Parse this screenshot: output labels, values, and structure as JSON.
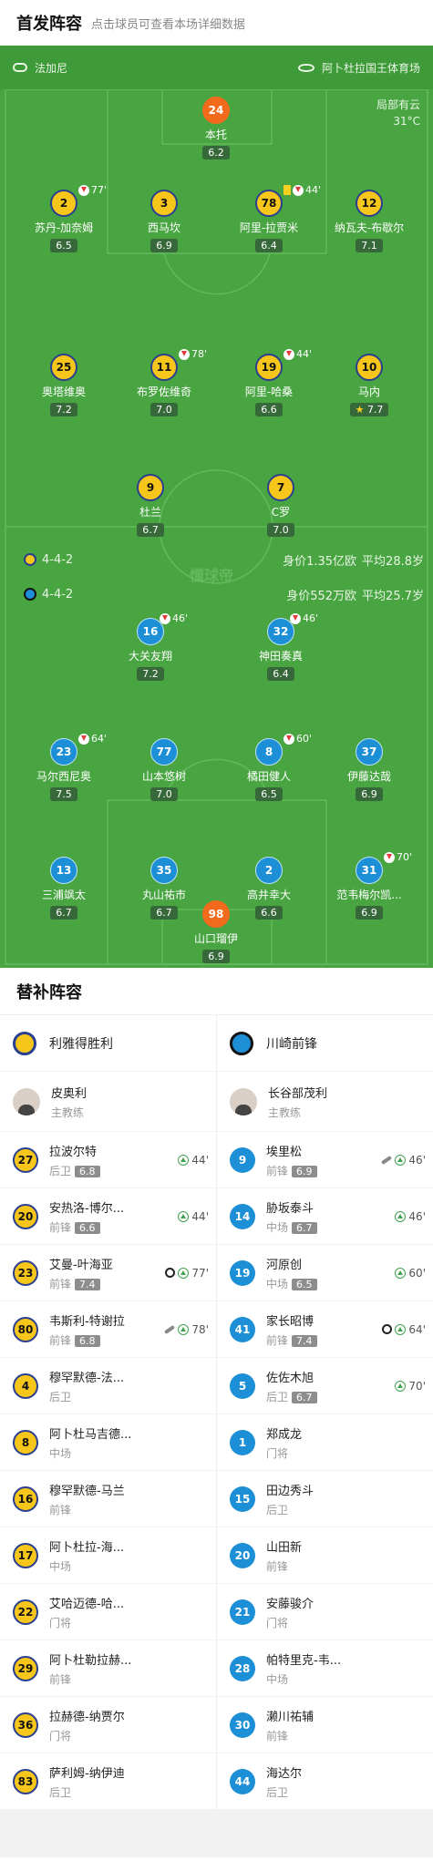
{
  "header": {
    "title": "首发阵容",
    "subtitle": "点击球员可查看本场详细数据"
  },
  "venue": {
    "referee": "法加尼",
    "stadium": "阿卜杜拉国王体育场"
  },
  "weather": {
    "condition": "局部有云",
    "temp": "31°C"
  },
  "home": {
    "formation": "4-4-2",
    "value": "身价1.35亿欧",
    "age": "平均28.8岁"
  },
  "away": {
    "formation": "4-4-2",
    "value": "身价552万欧",
    "age": "平均25.7岁"
  },
  "watermark": "懂球帝",
  "home_players": [
    {
      "num": "24",
      "name": "本托",
      "rating": "6.2",
      "gk": true
    },
    {
      "num": "2",
      "name": "苏丹-加奈姆",
      "rating": "6.5",
      "event": "77'"
    },
    {
      "num": "3",
      "name": "西马坎",
      "rating": "6.9"
    },
    {
      "num": "78",
      "name": "阿里-拉贾米",
      "rating": "6.4",
      "event": "44'"
    },
    {
      "num": "12",
      "name": "纳瓦夫-布歇尔",
      "rating": "7.1"
    },
    {
      "num": "25",
      "name": "奥塔维奥",
      "rating": "7.2"
    },
    {
      "num": "11",
      "name": "布罗佐维奇",
      "rating": "7.0",
      "event": "78'"
    },
    {
      "num": "19",
      "name": "阿里-哈桑",
      "rating": "6.6",
      "event": "44'"
    },
    {
      "num": "10",
      "name": "马内",
      "rating": "7.7"
    },
    {
      "num": "9",
      "name": "杜兰",
      "rating": "6.7"
    },
    {
      "num": "7",
      "name": "C罗",
      "rating": "7.0"
    }
  ],
  "away_players": [
    {
      "num": "16",
      "name": "大关友翔",
      "rating": "7.2",
      "event": "46'"
    },
    {
      "num": "32",
      "name": "神田奏真",
      "rating": "6.4",
      "event": "46'"
    },
    {
      "num": "23",
      "name": "马尔西尼奥",
      "rating": "7.5",
      "event": "64'"
    },
    {
      "num": "77",
      "name": "山本悠树",
      "rating": "7.0"
    },
    {
      "num": "8",
      "name": "橘田健人",
      "rating": "6.5",
      "event": "60'"
    },
    {
      "num": "37",
      "name": "伊藤达哉",
      "rating": "6.9"
    },
    {
      "num": "13",
      "name": "三浦飒太",
      "rating": "6.7"
    },
    {
      "num": "35",
      "name": "丸山祐市",
      "rating": "6.7"
    },
    {
      "num": "2",
      "name": "高井幸大",
      "rating": "6.6"
    },
    {
      "num": "31",
      "name": "范韦梅尔凯...",
      "rating": "6.9",
      "event": "70'"
    },
    {
      "num": "98",
      "name": "山口瑠伊",
      "rating": "6.9",
      "gk": true
    }
  ],
  "subs": {
    "title": "替补阵容",
    "home_team": "利雅得胜利",
    "away_team": "川崎前锋",
    "home_coach": {
      "name": "皮奥利",
      "role": "主教练"
    },
    "away_coach": {
      "name": "长谷部茂利",
      "role": "主教练"
    },
    "home": [
      {
        "num": "27",
        "name": "拉波尔特",
        "pos": "后卫",
        "rating": "6.8",
        "in": "44'"
      },
      {
        "num": "20",
        "name": "安热洛-博尔...",
        "pos": "前锋",
        "rating": "6.6",
        "in": "44'"
      },
      {
        "num": "23",
        "name": "艾曼-叶海亚",
        "pos": "前锋",
        "rating": "7.4",
        "in": "77'",
        "goal": true
      },
      {
        "num": "80",
        "name": "韦斯利-特谢拉",
        "pos": "前锋",
        "rating": "6.8",
        "in": "78'",
        "assist": true
      },
      {
        "num": "4",
        "name": "穆罕默德-法...",
        "pos": "后卫"
      },
      {
        "num": "8",
        "name": "阿卜杜马吉德...",
        "pos": "中场"
      },
      {
        "num": "16",
        "name": "穆罕默德-马兰",
        "pos": "前锋"
      },
      {
        "num": "17",
        "name": "阿卜杜拉-海...",
        "pos": "中场"
      },
      {
        "num": "22",
        "name": "艾哈迈德-哈...",
        "pos": "门将"
      },
      {
        "num": "29",
        "name": "阿卜杜勒拉赫...",
        "pos": "前锋"
      },
      {
        "num": "36",
        "name": "拉赫德-纳贾尔",
        "pos": "门将"
      },
      {
        "num": "83",
        "name": "萨利姆-纳伊迪",
        "pos": "后卫"
      }
    ],
    "away": [
      {
        "num": "9",
        "name": "埃里松",
        "pos": "前锋",
        "rating": "6.9",
        "in": "46'",
        "assist": true
      },
      {
        "num": "14",
        "name": "胁坂泰斗",
        "pos": "中场",
        "rating": "6.7",
        "in": "46'"
      },
      {
        "num": "19",
        "name": "河原创",
        "pos": "中场",
        "rating": "6.5",
        "in": "60'"
      },
      {
        "num": "41",
        "name": "家长昭博",
        "pos": "前锋",
        "rating": "7.4",
        "in": "64'",
        "goal": true
      },
      {
        "num": "5",
        "name": "佐佐木旭",
        "pos": "后卫",
        "rating": "6.7",
        "in": "70'"
      },
      {
        "num": "1",
        "name": "郑成龙",
        "pos": "门将"
      },
      {
        "num": "15",
        "name": "田边秀斗",
        "pos": "后卫"
      },
      {
        "num": "20",
        "name": "山田新",
        "pos": "前锋"
      },
      {
        "num": "21",
        "name": "安藤骏介",
        "pos": "门将"
      },
      {
        "num": "28",
        "name": "帕特里克-韦...",
        "pos": "中场"
      },
      {
        "num": "30",
        "name": "濑川祐辅",
        "pos": "前锋"
      },
      {
        "num": "44",
        "name": "海达尔",
        "pos": "后卫"
      }
    ]
  }
}
